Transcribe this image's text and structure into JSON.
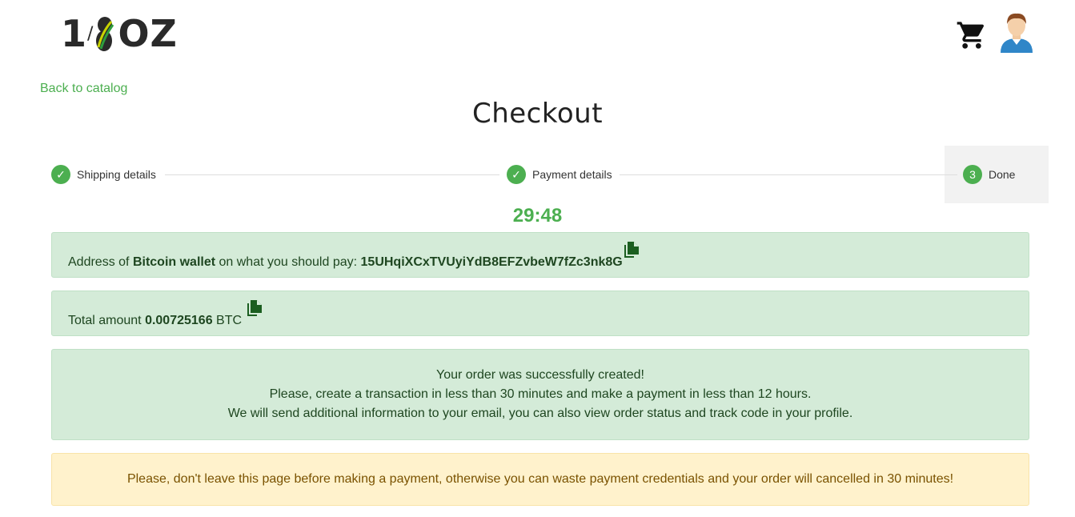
{
  "header": {
    "logo": {
      "text_one": "1",
      "text_slash": "/",
      "text_oz": "OZ",
      "alt": "1/8OZ"
    },
    "cart_icon": "cart-icon",
    "avatar_icon": "user-avatar-icon"
  },
  "nav": {
    "back_link": "Back to catalog"
  },
  "page": {
    "title": "Checkout"
  },
  "stepper": {
    "steps": [
      {
        "label": "Shipping details",
        "state": "complete",
        "marker": "✓"
      },
      {
        "label": "Payment details",
        "state": "complete",
        "marker": "✓"
      },
      {
        "label": "Done",
        "state": "active",
        "marker": "3"
      }
    ]
  },
  "timer": {
    "value": "29:48"
  },
  "wallet": {
    "prefix": "Address of ",
    "wallet_name": "Bitcoin wallet",
    "middle": " on what you should pay: ",
    "address": "15UHqiXCxTVUyiYdB8EFZvbeW7fZc3nk8G"
  },
  "amount": {
    "prefix": "Total amount ",
    "value": "0.00725166",
    "currency": " BTC"
  },
  "success_message": {
    "line1": "Your order was successfully created!",
    "line2": "Please, create a transaction in less than 30 minutes and make a payment in less than 12 hours.",
    "line3": "We will send additional information to your email, you can also view order status and track code in your profile."
  },
  "warning_message": {
    "text": "Please, don't leave this page before making a payment, otherwise you can waste payment credentials and your order will cancelled in 30 minutes!"
  },
  "colors": {
    "accent": "#4caf50",
    "success_bg": "#d4ebd8",
    "warning_bg": "#fff2cc",
    "copy_icon": "#1b5e20"
  }
}
